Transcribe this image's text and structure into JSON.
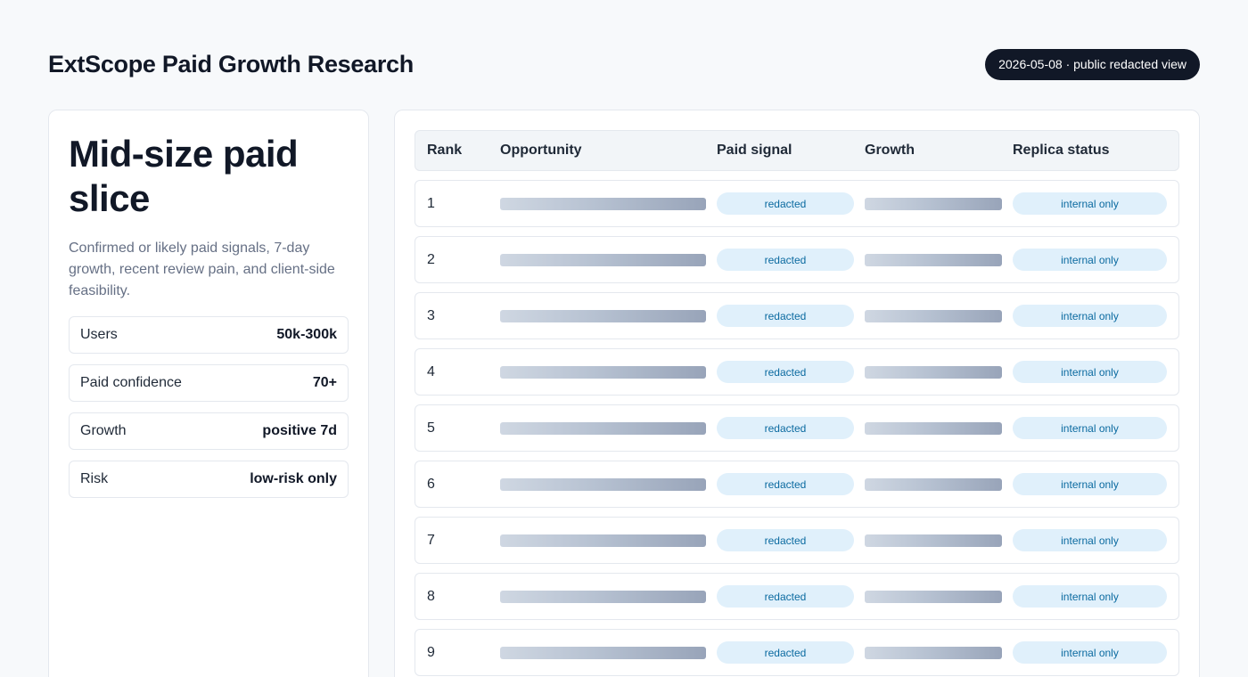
{
  "header": {
    "title": "ExtScope Paid Growth Research",
    "badge": "2026-05-08 · public redacted view"
  },
  "slice": {
    "title": "Mid-size paid slice",
    "description": "Confirmed or likely paid signals, 7-day growth, recent review pain, and client-side feasibility.",
    "metrics": [
      {
        "label": "Users",
        "value": "50k-300k"
      },
      {
        "label": "Paid confidence",
        "value": "70+"
      },
      {
        "label": "Growth",
        "value": "positive 7d"
      },
      {
        "label": "Risk",
        "value": "low-risk only"
      }
    ]
  },
  "table": {
    "columns": [
      "Rank",
      "Opportunity",
      "Paid signal",
      "Growth",
      "Replica status"
    ],
    "rows": [
      {
        "rank": "1",
        "paid": "redacted",
        "status": "internal only"
      },
      {
        "rank": "2",
        "paid": "redacted",
        "status": "internal only"
      },
      {
        "rank": "3",
        "paid": "redacted",
        "status": "internal only"
      },
      {
        "rank": "4",
        "paid": "redacted",
        "status": "internal only"
      },
      {
        "rank": "5",
        "paid": "redacted",
        "status": "internal only"
      },
      {
        "rank": "6",
        "paid": "redacted",
        "status": "internal only"
      },
      {
        "rank": "7",
        "paid": "redacted",
        "status": "internal only"
      },
      {
        "rank": "8",
        "paid": "redacted",
        "status": "internal only"
      },
      {
        "rank": "9",
        "paid": "redacted",
        "status": "internal only"
      }
    ]
  },
  "colors": {
    "badge_bg": "#111827",
    "pill_bg": "#e0f0fb",
    "pill_text": "#0b6aa0",
    "redaction_bar": "#a7b2c4"
  }
}
